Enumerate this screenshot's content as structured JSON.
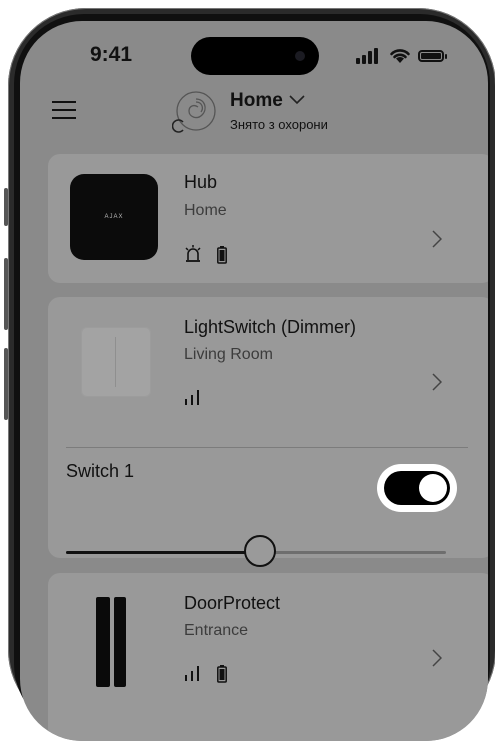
{
  "status_bar": {
    "time": "9:41"
  },
  "header": {
    "hub_name": "Home",
    "hub_status": "Знято з охорони"
  },
  "devices": [
    {
      "name": "Hub",
      "room": "Home",
      "image_label": "AJAX",
      "icons": [
        "siren-icon",
        "battery-icon"
      ]
    },
    {
      "name": "LightSwitch (Dimmer)",
      "room": "Living Room",
      "icons": [
        "signal-icon"
      ],
      "switch": {
        "label": "Switch 1",
        "on": true,
        "brightness_percent": 51
      }
    },
    {
      "name": "DoorProtect",
      "room": "Entrance",
      "icons": [
        "signal-icon",
        "battery-icon"
      ]
    }
  ],
  "colors": {
    "background": "#8a8a8a",
    "card": "#999999",
    "toggle_on": "#000000"
  }
}
